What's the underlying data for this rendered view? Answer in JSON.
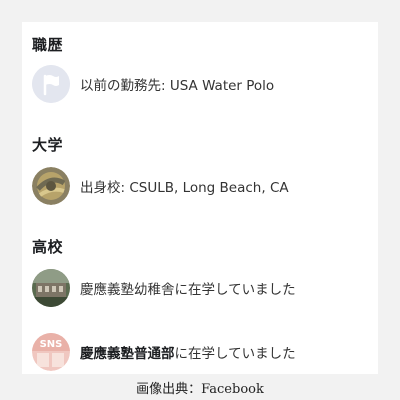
{
  "sections": {
    "work": {
      "title": "職歴",
      "item": {
        "icon": "flag-icon",
        "text": "以前の勤務先: USA Water Polo"
      }
    },
    "university": {
      "title": "大学",
      "item": {
        "icon": "school-photo-icon",
        "text": "出身校: CSULB, Long Beach, CA"
      }
    },
    "high_school": {
      "title": "高校",
      "items": [
        {
          "icon": "school-photo-icon",
          "text": "慶應義塾幼稚舎に在学していました"
        },
        {
          "icon": "sns-badge-icon",
          "bold": "慶應義塾普通部",
          "suffix": "に在学していました",
          "badge_text": "SNS"
        }
      ]
    }
  },
  "caption": "画像出典：Facebook"
}
